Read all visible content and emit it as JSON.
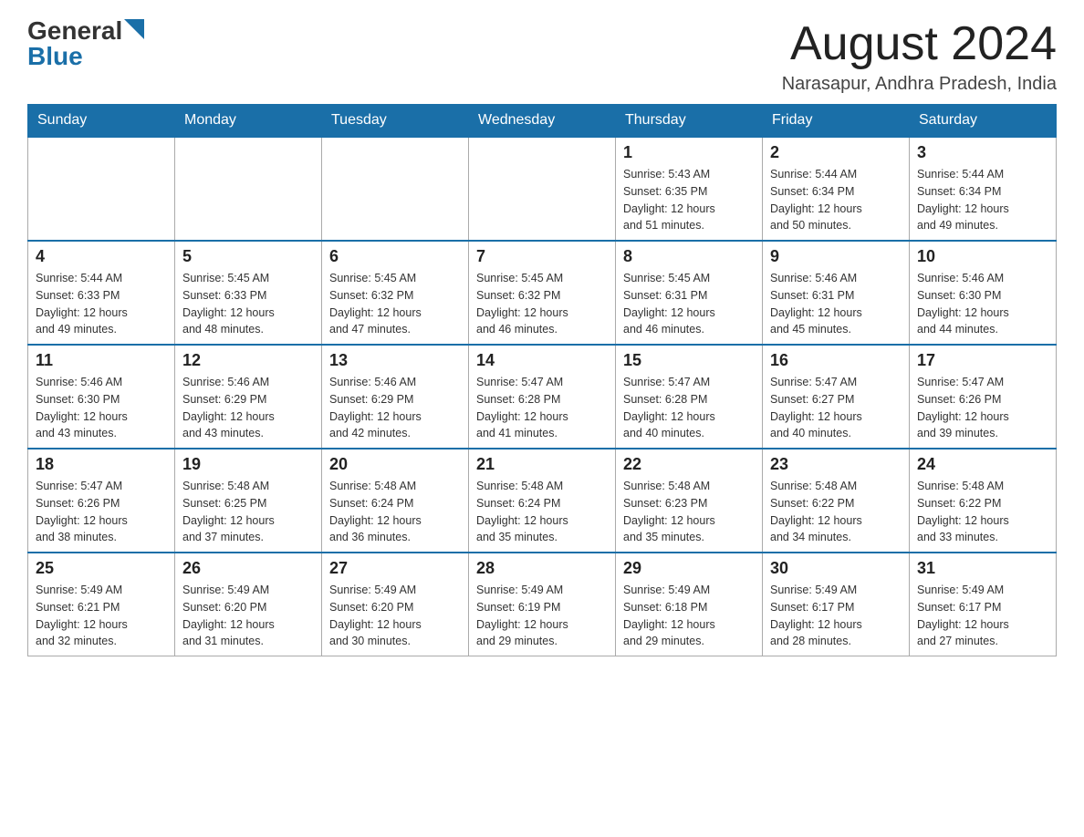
{
  "header": {
    "logo_general": "General",
    "logo_blue": "Blue",
    "month_title": "August 2024",
    "location": "Narasapur, Andhra Pradesh, India"
  },
  "days_of_week": [
    "Sunday",
    "Monday",
    "Tuesday",
    "Wednesday",
    "Thursday",
    "Friday",
    "Saturday"
  ],
  "weeks": [
    [
      {
        "day": "",
        "info": ""
      },
      {
        "day": "",
        "info": ""
      },
      {
        "day": "",
        "info": ""
      },
      {
        "day": "",
        "info": ""
      },
      {
        "day": "1",
        "info": "Sunrise: 5:43 AM\nSunset: 6:35 PM\nDaylight: 12 hours\nand 51 minutes."
      },
      {
        "day": "2",
        "info": "Sunrise: 5:44 AM\nSunset: 6:34 PM\nDaylight: 12 hours\nand 50 minutes."
      },
      {
        "day": "3",
        "info": "Sunrise: 5:44 AM\nSunset: 6:34 PM\nDaylight: 12 hours\nand 49 minutes."
      }
    ],
    [
      {
        "day": "4",
        "info": "Sunrise: 5:44 AM\nSunset: 6:33 PM\nDaylight: 12 hours\nand 49 minutes."
      },
      {
        "day": "5",
        "info": "Sunrise: 5:45 AM\nSunset: 6:33 PM\nDaylight: 12 hours\nand 48 minutes."
      },
      {
        "day": "6",
        "info": "Sunrise: 5:45 AM\nSunset: 6:32 PM\nDaylight: 12 hours\nand 47 minutes."
      },
      {
        "day": "7",
        "info": "Sunrise: 5:45 AM\nSunset: 6:32 PM\nDaylight: 12 hours\nand 46 minutes."
      },
      {
        "day": "8",
        "info": "Sunrise: 5:45 AM\nSunset: 6:31 PM\nDaylight: 12 hours\nand 46 minutes."
      },
      {
        "day": "9",
        "info": "Sunrise: 5:46 AM\nSunset: 6:31 PM\nDaylight: 12 hours\nand 45 minutes."
      },
      {
        "day": "10",
        "info": "Sunrise: 5:46 AM\nSunset: 6:30 PM\nDaylight: 12 hours\nand 44 minutes."
      }
    ],
    [
      {
        "day": "11",
        "info": "Sunrise: 5:46 AM\nSunset: 6:30 PM\nDaylight: 12 hours\nand 43 minutes."
      },
      {
        "day": "12",
        "info": "Sunrise: 5:46 AM\nSunset: 6:29 PM\nDaylight: 12 hours\nand 43 minutes."
      },
      {
        "day": "13",
        "info": "Sunrise: 5:46 AM\nSunset: 6:29 PM\nDaylight: 12 hours\nand 42 minutes."
      },
      {
        "day": "14",
        "info": "Sunrise: 5:47 AM\nSunset: 6:28 PM\nDaylight: 12 hours\nand 41 minutes."
      },
      {
        "day": "15",
        "info": "Sunrise: 5:47 AM\nSunset: 6:28 PM\nDaylight: 12 hours\nand 40 minutes."
      },
      {
        "day": "16",
        "info": "Sunrise: 5:47 AM\nSunset: 6:27 PM\nDaylight: 12 hours\nand 40 minutes."
      },
      {
        "day": "17",
        "info": "Sunrise: 5:47 AM\nSunset: 6:26 PM\nDaylight: 12 hours\nand 39 minutes."
      }
    ],
    [
      {
        "day": "18",
        "info": "Sunrise: 5:47 AM\nSunset: 6:26 PM\nDaylight: 12 hours\nand 38 minutes."
      },
      {
        "day": "19",
        "info": "Sunrise: 5:48 AM\nSunset: 6:25 PM\nDaylight: 12 hours\nand 37 minutes."
      },
      {
        "day": "20",
        "info": "Sunrise: 5:48 AM\nSunset: 6:24 PM\nDaylight: 12 hours\nand 36 minutes."
      },
      {
        "day": "21",
        "info": "Sunrise: 5:48 AM\nSunset: 6:24 PM\nDaylight: 12 hours\nand 35 minutes."
      },
      {
        "day": "22",
        "info": "Sunrise: 5:48 AM\nSunset: 6:23 PM\nDaylight: 12 hours\nand 35 minutes."
      },
      {
        "day": "23",
        "info": "Sunrise: 5:48 AM\nSunset: 6:22 PM\nDaylight: 12 hours\nand 34 minutes."
      },
      {
        "day": "24",
        "info": "Sunrise: 5:48 AM\nSunset: 6:22 PM\nDaylight: 12 hours\nand 33 minutes."
      }
    ],
    [
      {
        "day": "25",
        "info": "Sunrise: 5:49 AM\nSunset: 6:21 PM\nDaylight: 12 hours\nand 32 minutes."
      },
      {
        "day": "26",
        "info": "Sunrise: 5:49 AM\nSunset: 6:20 PM\nDaylight: 12 hours\nand 31 minutes."
      },
      {
        "day": "27",
        "info": "Sunrise: 5:49 AM\nSunset: 6:20 PM\nDaylight: 12 hours\nand 30 minutes."
      },
      {
        "day": "28",
        "info": "Sunrise: 5:49 AM\nSunset: 6:19 PM\nDaylight: 12 hours\nand 29 minutes."
      },
      {
        "day": "29",
        "info": "Sunrise: 5:49 AM\nSunset: 6:18 PM\nDaylight: 12 hours\nand 29 minutes."
      },
      {
        "day": "30",
        "info": "Sunrise: 5:49 AM\nSunset: 6:17 PM\nDaylight: 12 hours\nand 28 minutes."
      },
      {
        "day": "31",
        "info": "Sunrise: 5:49 AM\nSunset: 6:17 PM\nDaylight: 12 hours\nand 27 minutes."
      }
    ]
  ]
}
